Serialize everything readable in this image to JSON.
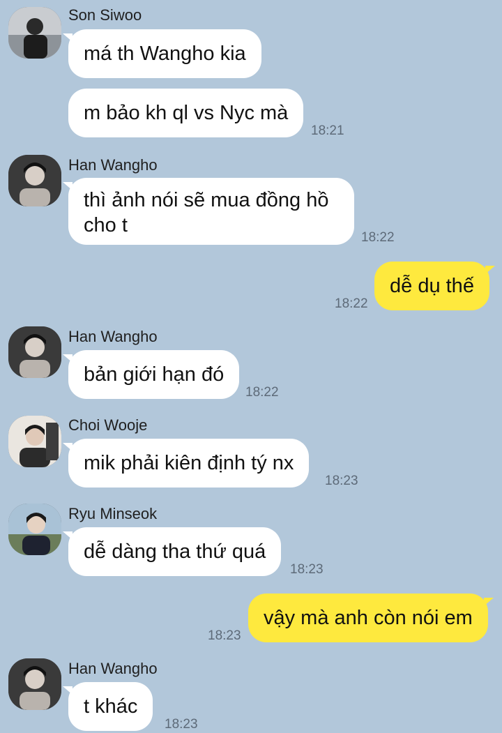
{
  "messages": [
    {
      "sender": "Son Siwoo",
      "text": "má th Wangho kia",
      "time": ""
    },
    {
      "sender": "Son Siwoo",
      "text": "m bảo kh ql vs Nyc mà",
      "time": "18:21"
    },
    {
      "sender": "Han Wangho",
      "text": "thì ảnh nói sẽ mua đồng hồ cho t",
      "time": "18:22"
    },
    {
      "sender": "me",
      "text": "dễ dụ thế",
      "time": "18:22"
    },
    {
      "sender": "Han Wangho",
      "text": "bản giới hạn đó",
      "time": "18:22"
    },
    {
      "sender": "Choi Wooje",
      "text": "mik phải kiên định tý nx",
      "time": "18:23"
    },
    {
      "sender": "Ryu Minseok",
      "text": "dễ dàng tha thứ quá",
      "time": "18:23"
    },
    {
      "sender": "me",
      "text": "vậy mà anh còn nói em",
      "time": "18:23"
    },
    {
      "sender": "Han Wangho",
      "text": "t khác",
      "time": "18:23"
    }
  ],
  "colors": {
    "background": "#b2c7da",
    "incoming_bubble": "#ffffff",
    "outgoing_bubble": "#fee93e",
    "timestamp": "#5d6a78"
  }
}
